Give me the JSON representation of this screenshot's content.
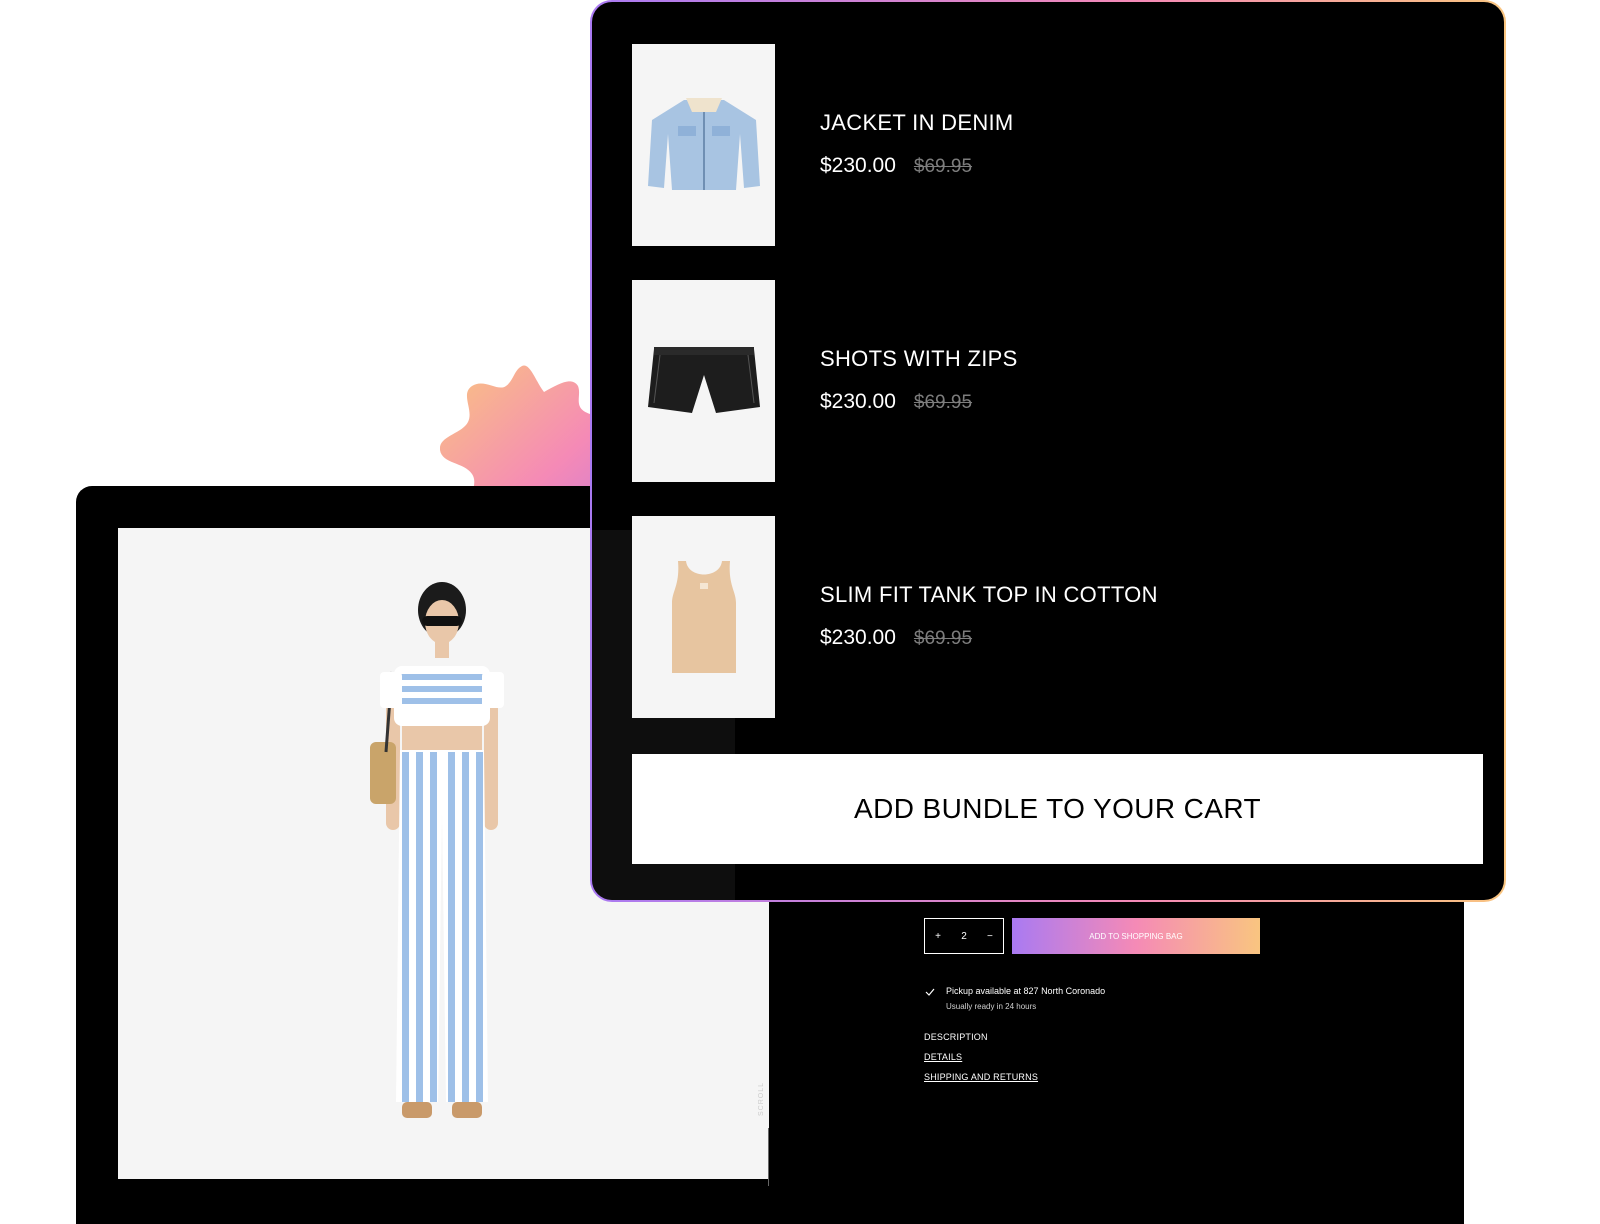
{
  "bundle": {
    "items": [
      {
        "name": "JACKET IN DENIM",
        "price": "$230.00",
        "old_price": "$69.95",
        "icon": "denim-jacket-icon"
      },
      {
        "name": "SHOTS WITH ZIPS",
        "price": "$230.00",
        "old_price": "$69.95",
        "icon": "shorts-icon"
      },
      {
        "name": "SLIM FIT TANK TOP IN COTTON",
        "price": "$230.00",
        "old_price": "$69.95",
        "icon": "tank-top-icon"
      }
    ],
    "cta_label": "ADD  BUNDLE TO YOUR CART"
  },
  "product": {
    "scroll_label": "SCROLL",
    "quantity": {
      "increase": "+",
      "value": "2",
      "decrease": "−"
    },
    "add_to_bag_label": "ADD TO SHOPPING BAG",
    "pickup": {
      "line1": "Pickup available at 827 North Coronado",
      "line2": "Usually ready in 24 hours"
    },
    "links": {
      "description": "DESCRIPTION",
      "details": "DETAILS",
      "shipping": "SHIPPING AND RETURNS"
    }
  },
  "colors": {
    "gradient_start": "#a97af2",
    "gradient_mid": "#f58ab6",
    "gradient_end": "#f9c580",
    "panel_bg": "#000000",
    "image_bg": "#f5f5f5"
  }
}
